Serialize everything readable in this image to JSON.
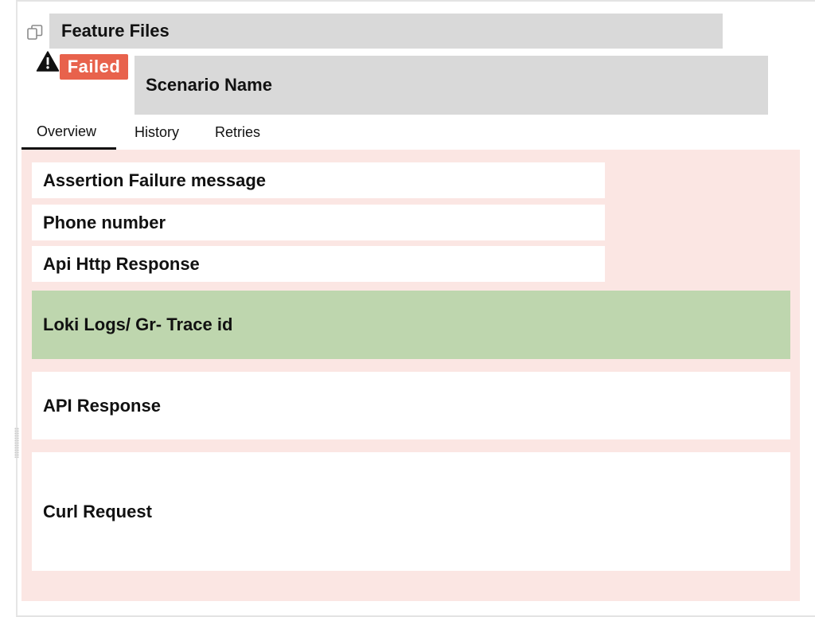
{
  "header": {
    "title": "Feature Files",
    "status_badge": "Failed",
    "scenario_name": "Scenario Name",
    "icons": [
      "copy-icon",
      "warning-icon"
    ]
  },
  "tabs": [
    {
      "label": "Overview",
      "active": true
    },
    {
      "label": "History",
      "active": false
    },
    {
      "label": "Retries",
      "active": false
    }
  ],
  "sections": [
    {
      "label": "Assertion Failure message"
    },
    {
      "label": "Phone number"
    },
    {
      "label": "Api Http Response"
    },
    {
      "label": "Loki Logs/ Gr- Trace id"
    },
    {
      "label": "API Response"
    },
    {
      "label": "Curl Request"
    }
  ],
  "colors": {
    "failed_badge": "#e8624c",
    "failure_panel": "#fbe6e3",
    "highlight_section": "#bed6ae",
    "placeholder_bar": "#d9d9d9"
  }
}
